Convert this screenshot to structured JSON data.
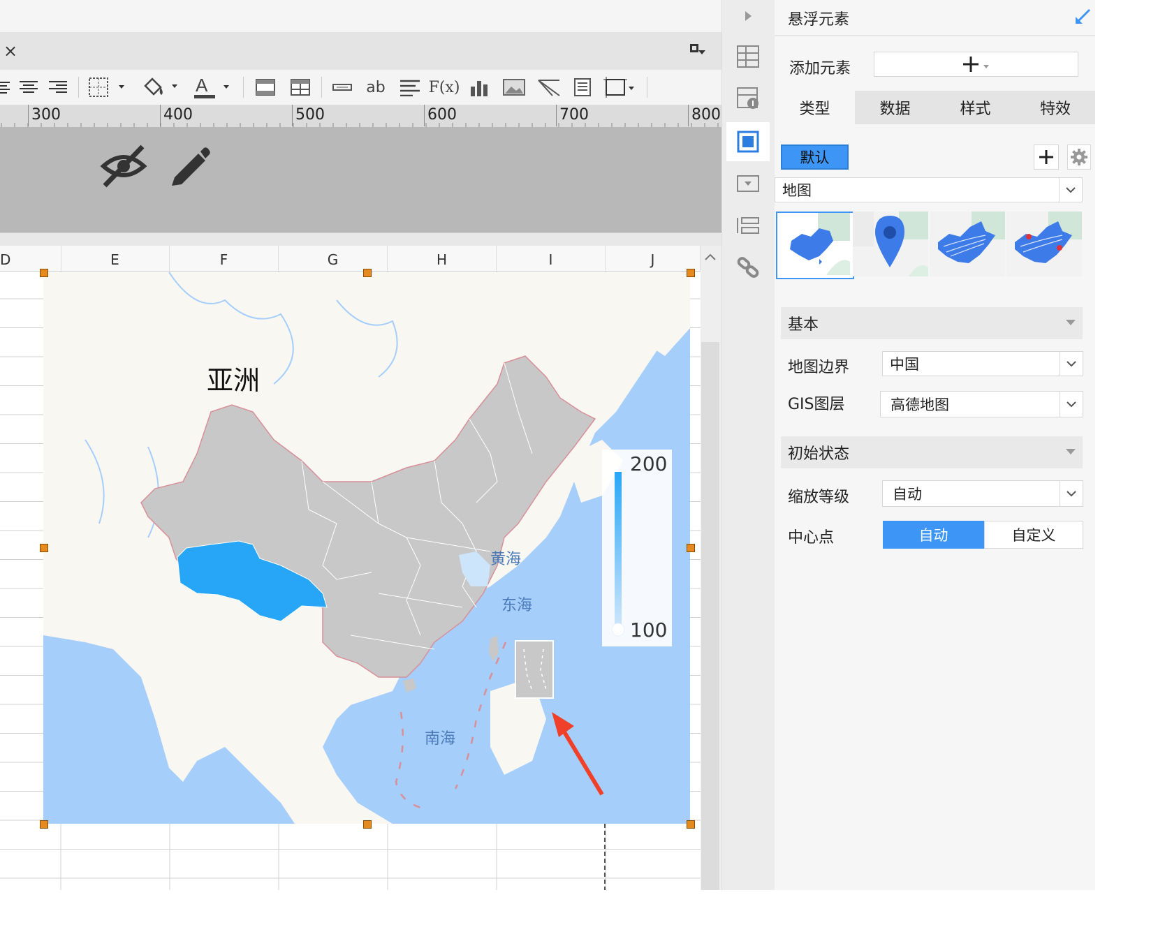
{
  "editor": {
    "tab_close": "×",
    "ruler_marks": [
      "300",
      "400",
      "500",
      "600",
      "700",
      "800"
    ],
    "columns": [
      "D",
      "E",
      "F",
      "G",
      "H",
      "I",
      "J"
    ],
    "map": {
      "continent_label": "亚洲",
      "sea_labels": [
        "黄海",
        "东海",
        "南海"
      ],
      "legend_max": "200",
      "legend_min": "100"
    },
    "toolbar_text": {
      "ab": "ab",
      "fx": "F(x)",
      "font_a": "A"
    }
  },
  "panel": {
    "title": "悬浮元素",
    "add_element_label": "添加元素",
    "tabs": [
      "类型",
      "数据",
      "样式",
      "特效"
    ],
    "active_tab": "类型",
    "default_button": "默认",
    "chart_type_select": "地图",
    "sections": {
      "basic": "基本",
      "initial_state": "初始状态"
    },
    "fields": {
      "map_boundary_label": "地图边界",
      "map_boundary_value": "中国",
      "gis_layer_label": "GIS图层",
      "gis_layer_value": "高德地图",
      "zoom_label": "缩放等级",
      "zoom_value": "自动",
      "center_label": "中心点",
      "center_options": [
        "自动",
        "自定义"
      ],
      "center_selected": "自动"
    }
  },
  "colors": {
    "accent": "#3d96f5",
    "highlight_region": "#27a6f7",
    "sea": "#a6cefb",
    "land": "#f9f7f2",
    "china": "#c8c8c8",
    "arrow": "#f0402a"
  }
}
